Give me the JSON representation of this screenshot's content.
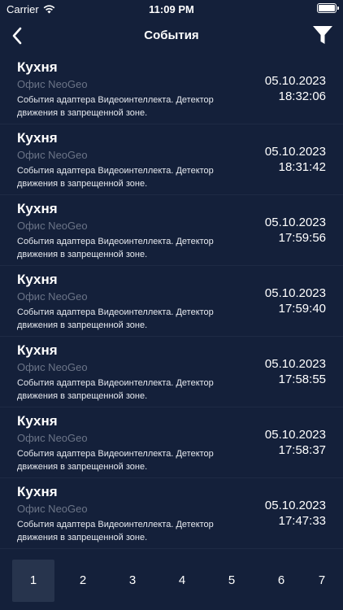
{
  "status_bar": {
    "carrier": "Carrier",
    "time": "11:09 PM"
  },
  "header": {
    "title": "События"
  },
  "events": [
    {
      "title": "Кухня",
      "location": "Офис NeoGeo",
      "description": "События адаптера Видеоинтеллекта. Детектор движения в запрещенной зоне.",
      "date": "05.10.2023",
      "time": "18:32:06"
    },
    {
      "title": "Кухня",
      "location": "Офис NeoGeo",
      "description": "События адаптера Видеоинтеллекта. Детектор движения в запрещенной зоне.",
      "date": "05.10.2023",
      "time": "18:31:42"
    },
    {
      "title": "Кухня",
      "location": "Офис NeoGeo",
      "description": "События адаптера Видеоинтеллекта. Детектор движения в запрещенной зоне.",
      "date": "05.10.2023",
      "time": "17:59:56"
    },
    {
      "title": "Кухня",
      "location": "Офис NeoGeo",
      "description": "События адаптера Видеоинтеллекта. Детектор движения в запрещенной зоне.",
      "date": "05.10.2023",
      "time": "17:59:40"
    },
    {
      "title": "Кухня",
      "location": "Офис NeoGeo",
      "description": "События адаптера Видеоинтеллекта. Детектор движения в запрещенной зоне.",
      "date": "05.10.2023",
      "time": "17:58:55"
    },
    {
      "title": "Кухня",
      "location": "Офис NeoGeo",
      "description": "События адаптера Видеоинтеллекта. Детектор движения в запрещенной зоне.",
      "date": "05.10.2023",
      "time": "17:58:37"
    },
    {
      "title": "Кухня",
      "location": "Офис NeoGeo",
      "description": "События адаптера Видеоинтеллекта. Детектор движения в запрещенной зоне.",
      "date": "05.10.2023",
      "time": "17:47:33"
    }
  ],
  "pagination": {
    "pages": [
      "1",
      "2",
      "3",
      "4",
      "5",
      "6",
      "7"
    ],
    "active": "1"
  },
  "colors": {
    "background": "#14203a",
    "divider": "#1e2a44",
    "secondary_text": "#6b7487",
    "active_page": "#27344d"
  }
}
